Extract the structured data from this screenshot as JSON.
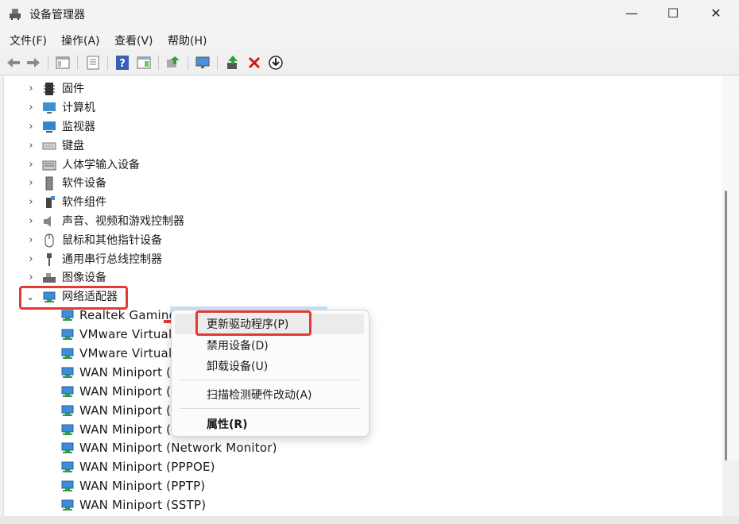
{
  "window": {
    "title": "设备管理器",
    "minimize": "—",
    "maximize": "☐",
    "close": "✕"
  },
  "menu": [
    "文件(F)",
    "操作(A)",
    "查看(V)",
    "帮助(H)"
  ],
  "toolbar": [
    "back-icon",
    "forward-icon",
    "properties-pane-icon",
    "list-icon",
    "help-icon",
    "window-icon",
    "update-driver-icon",
    "monitor-icon",
    "enable-device-icon",
    "remove-device-icon",
    "download-icon"
  ],
  "tree": {
    "categories": [
      {
        "label": "固件",
        "icon": "firmware-icon"
      },
      {
        "label": "计算机",
        "icon": "computer-icon"
      },
      {
        "label": "监视器",
        "icon": "monitor-icon"
      },
      {
        "label": "键盘",
        "icon": "keyboard-icon"
      },
      {
        "label": "人体学输入设备",
        "icon": "hid-icon"
      },
      {
        "label": "软件设备",
        "icon": "software-device-icon"
      },
      {
        "label": "软件组件",
        "icon": "software-component-icon"
      },
      {
        "label": "声音、视频和游戏控制器",
        "icon": "speaker-icon"
      },
      {
        "label": "鼠标和其他指针设备",
        "icon": "mouse-icon"
      },
      {
        "label": "通用串行总线控制器",
        "icon": "usb-icon"
      },
      {
        "label": "图像设备",
        "icon": "camera-icon"
      }
    ],
    "expanded": {
      "label": "网络适配器",
      "icon": "network-adapter-icon"
    },
    "adapters": [
      "Realtek Gaming",
      "VMware Virtual E",
      "VMware Virtual E",
      "WAN Miniport (I",
      "WAN Miniport (I",
      "WAN Miniport (I",
      "WAN Miniport (L",
      "WAN Miniport (Network Monitor)",
      "WAN Miniport (PPPOE)",
      "WAN Miniport (PPTP)",
      "WAN Miniport (SSTP)"
    ]
  },
  "context_menu": {
    "update": "更新驱动程序(P)",
    "disable": "禁用设备(D)",
    "uninstall": "卸载设备(U)",
    "scan": "扫描检测硬件改动(A)",
    "properties": "属性(R)"
  },
  "colors": {
    "highlight": "#e53935",
    "selection": "#cce4f7",
    "accent": "#1e6fd9"
  }
}
